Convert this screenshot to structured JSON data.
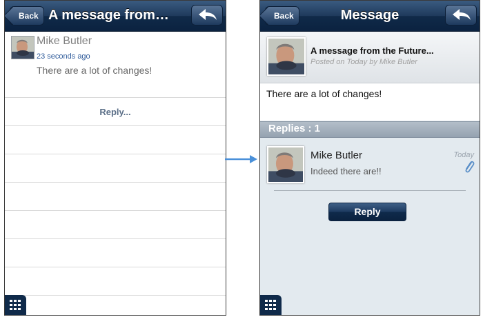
{
  "left": {
    "back_label": "Back",
    "title": "A message from…",
    "author": "Mike Butler",
    "time": "23 seconds ago",
    "text": "There are a lot of changes!",
    "reply_link": "Reply..."
  },
  "right": {
    "back_label": "Back",
    "title": "Message",
    "message_title": "A message from the Future...",
    "posted": "Posted on Today by Mike Butler",
    "body": "There are a lot of changes!",
    "replies_label": "Replies : 1",
    "reply": {
      "author": "Mike Butler",
      "text": "Indeed there are!!",
      "date": "Today"
    },
    "reply_button": "Reply"
  },
  "colors": {
    "navbar": "#102a49",
    "link": "#2f5b9a",
    "replies_bar": "#a2aebb",
    "background_right": "#e3eaef"
  },
  "icons": [
    "back-arrow-icon",
    "reply-arrow-icon",
    "grid-menu-icon",
    "paperclip-icon",
    "flow-arrow-icon"
  ]
}
